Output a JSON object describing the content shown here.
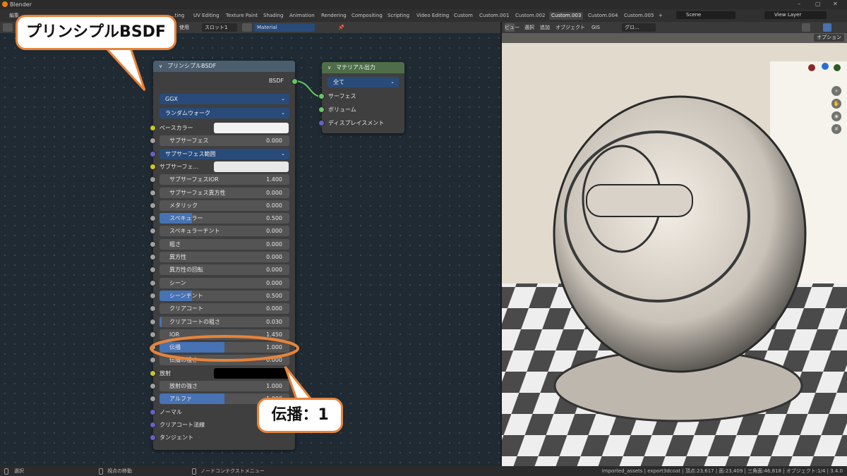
{
  "window": {
    "title": "Blender",
    "controls": [
      "–",
      "▢",
      "✕"
    ]
  },
  "menu": {
    "edit": "編集"
  },
  "workspace_tabs": [
    "...ting",
    "UV Editing",
    "Texture Paint",
    "Shading",
    "Animation",
    "Rendering",
    "Compositing",
    "Scripting",
    "Video Editing",
    "Custom",
    "Custom.001",
    "Custom.002",
    "Custom.003",
    "Custom.004",
    "Custom.005"
  ],
  "active_tab": "Custom.003",
  "add_tab": "+",
  "scene": {
    "label": "Scene",
    "view_layer": "View Layer"
  },
  "node_header": {
    "use_fragment": "使用",
    "slot": "スロット1",
    "material": "Material"
  },
  "viewport_header": {
    "view": "ビュー",
    "select": "選択",
    "add": "追加",
    "object": "オブジェクト",
    "gis": "GIS",
    "global": "グロ...",
    "options": "オプション"
  },
  "principled_node": {
    "title": "プリンシプルBSDF",
    "output_label": "BSDF",
    "distribution": "GGX",
    "subsurface_method": "ランダムウォーク",
    "base_color_label": "ベースカラー",
    "subsurface_radius": "サブサーフェス範囲",
    "subsurface_color_label": "サブサーフェ...",
    "fields": [
      {
        "label": "サブサーフェス",
        "value": "0.000",
        "fill": 0.0
      },
      {
        "label": "サブサーフェスIOR",
        "value": "1.400",
        "fill": 0.0
      },
      {
        "label": "サブサーフェス異方性",
        "value": "0.000",
        "fill": 0.0
      },
      {
        "label": "メタリック",
        "value": "0.000",
        "fill": 0.0
      },
      {
        "label": "スペキュラー",
        "value": "0.500",
        "fill": 0.5
      },
      {
        "label": "スペキュラーチント",
        "value": "0.000",
        "fill": 0.0
      },
      {
        "label": "粗さ",
        "value": "0.000",
        "fill": 0.0
      },
      {
        "label": "異方性",
        "value": "0.000",
        "fill": 0.0
      },
      {
        "label": "異方性の回転",
        "value": "0.000",
        "fill": 0.0
      },
      {
        "label": "シーン",
        "value": "0.000",
        "fill": 0.0
      },
      {
        "label": "シーンチント",
        "value": "0.500",
        "fill": 0.5
      },
      {
        "label": "クリアコート",
        "value": "0.000",
        "fill": 0.0
      },
      {
        "label": "クリアコートの粗さ",
        "value": "0.030",
        "fill": 0.03
      },
      {
        "label": "IOR",
        "value": "1.450",
        "fill": 0.0
      },
      {
        "label": "伝播",
        "value": "1.000",
        "fill": 1.0
      },
      {
        "label": "伝播の粗さ",
        "value": "0.000",
        "fill": 0.0
      }
    ],
    "emission_label": "放射",
    "emission_strength": {
      "label": "放射の強さ",
      "value": "1.000"
    },
    "alpha": {
      "label": "アルファ",
      "value": "1.000"
    },
    "normal_label": "ノーマル",
    "clearcoat_normal_label": "クリアコート法線",
    "tangent_label": "タンジェント"
  },
  "output_node": {
    "title": "マテリアル出力",
    "target": "全て",
    "surface": "サーフェス",
    "volume": "ボリューム",
    "displacement": "ディスプレイスメント"
  },
  "annotations": {
    "title_callout": "プリンシプルBSDF",
    "value_callout": "伝播：1"
  },
  "status": {
    "select": "選択",
    "move_view": "視点の移動",
    "node_menu": "ノードコンテクストメニュー",
    "right": "imported_assets | export3dcoat | 頂点:23,617 | 面:23,409 | 三角面:46,818 | オブジェクト:1/4 | 3.4.0"
  },
  "colors": {
    "accent": "#e8833a",
    "node_header_principled": "#4a5e6e",
    "node_header_output": "#4e6e4a",
    "active_field": "#4772b3"
  }
}
